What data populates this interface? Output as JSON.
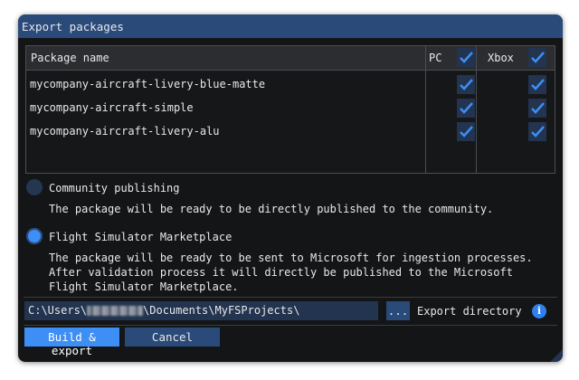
{
  "window": {
    "title": "Export packages"
  },
  "table": {
    "header": {
      "name": "Package name",
      "pc": "PC",
      "xbox": "Xbox"
    },
    "rows": [
      {
        "name": "mycompany-aircraft-livery-blue-matte",
        "pc": true,
        "xbox": true
      },
      {
        "name": "mycompany-aircraft-simple",
        "pc": true,
        "xbox": true
      },
      {
        "name": "mycompany-aircraft-livery-alu",
        "pc": true,
        "xbox": true
      }
    ]
  },
  "options": [
    {
      "label": "Community publishing",
      "selected": false,
      "description": "The package will be ready to be directly published to the community."
    },
    {
      "label": "Flight Simulator Marketplace",
      "selected": true,
      "description_lines": [
        "The package will be ready to be sent to Microsoft for ingestion processes.",
        "After validation process it will directly be published to the Microsoft",
        "Flight Simulator Marketplace."
      ]
    }
  ],
  "export": {
    "path_prefix": "C:\\Users\\",
    "path_suffix": "\\Documents\\MyFSProjects\\",
    "browse_label": "...",
    "label": "Export directory"
  },
  "buttons": {
    "build": "Build & export",
    "cancel": "Cancel"
  },
  "colors": {
    "accent": "#3d8ef5",
    "title_bar": "#2a4a7a"
  }
}
